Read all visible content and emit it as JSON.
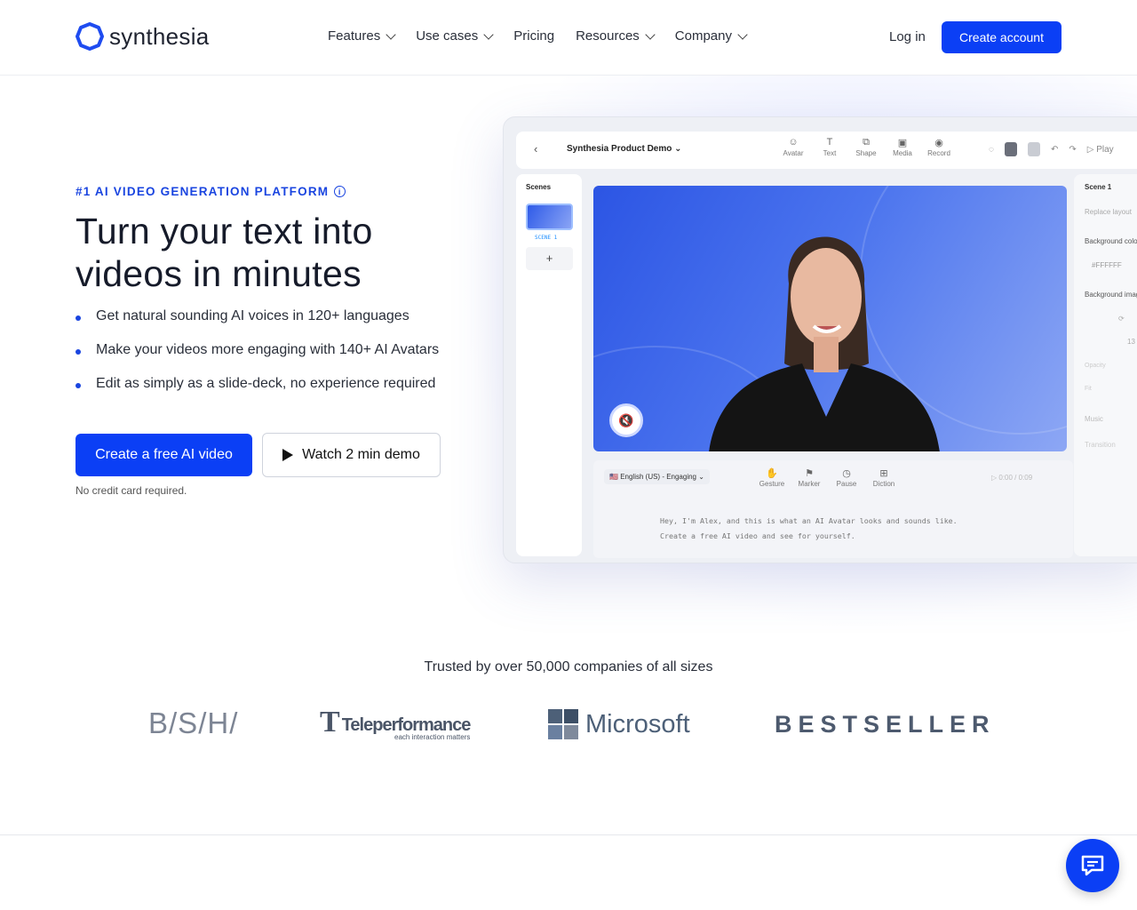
{
  "nav": {
    "brand": "synthesia",
    "menu": [
      {
        "label": "Features",
        "dropdown": true
      },
      {
        "label": "Use cases",
        "dropdown": true
      },
      {
        "label": "Pricing",
        "dropdown": false
      },
      {
        "label": "Resources",
        "dropdown": true
      },
      {
        "label": "Company",
        "dropdown": true
      }
    ],
    "login": "Log in",
    "create_account": "Create account"
  },
  "hero": {
    "eyebrow": "#1 AI VIDEO GENERATION PLATFORM",
    "title": "Turn your text into videos in minutes",
    "bullets": [
      "Get natural sounding AI voices in 120+ languages",
      "Make your videos more engaging with 140+ AI Avatars",
      "Edit as simply as a slide-deck, no experience required"
    ],
    "primary_cta": "Create a free AI video",
    "secondary_cta": "Watch 2 min demo",
    "note": "No credit card required."
  },
  "editor": {
    "project_title": "Synthesia Product Demo",
    "tools": [
      "Avatar",
      "Text",
      "Shape",
      "Media",
      "Record"
    ],
    "play": "Play",
    "scenes_label": "Scenes",
    "scene_thumb": "SCENE 1",
    "add": "+",
    "language": "English (US) - Engaging",
    "script_tools": [
      "Gesture",
      "Marker",
      "Pause",
      "Diction"
    ],
    "time": "0:00 / 0:09",
    "script_line1": "Hey, I'm Alex, and this is what an AI Avatar looks and sounds like.",
    "script_line2": "Create a free AI video and see for yourself.",
    "panel": {
      "scene": "Scene 1",
      "replace": "Replace layout",
      "bg_color": "Background color",
      "color_value": "#FFFFFF",
      "bg_image": "Background image",
      "value": "13",
      "opacity": "Opacity",
      "fit": "Fit",
      "music": "Music",
      "transition": "Transition"
    }
  },
  "trusted": {
    "text": "Trusted by over 50,000 companies of all sizes",
    "logos": [
      "B/S/H/",
      "Teleperformance",
      "Microsoft",
      "BESTSELLER"
    ],
    "tp_tagline": "each interaction matters"
  },
  "colors": {
    "accent": "#0b3ff5",
    "eyebrow": "#1a45e0"
  },
  "chat": {
    "icon": "chat-icon"
  }
}
